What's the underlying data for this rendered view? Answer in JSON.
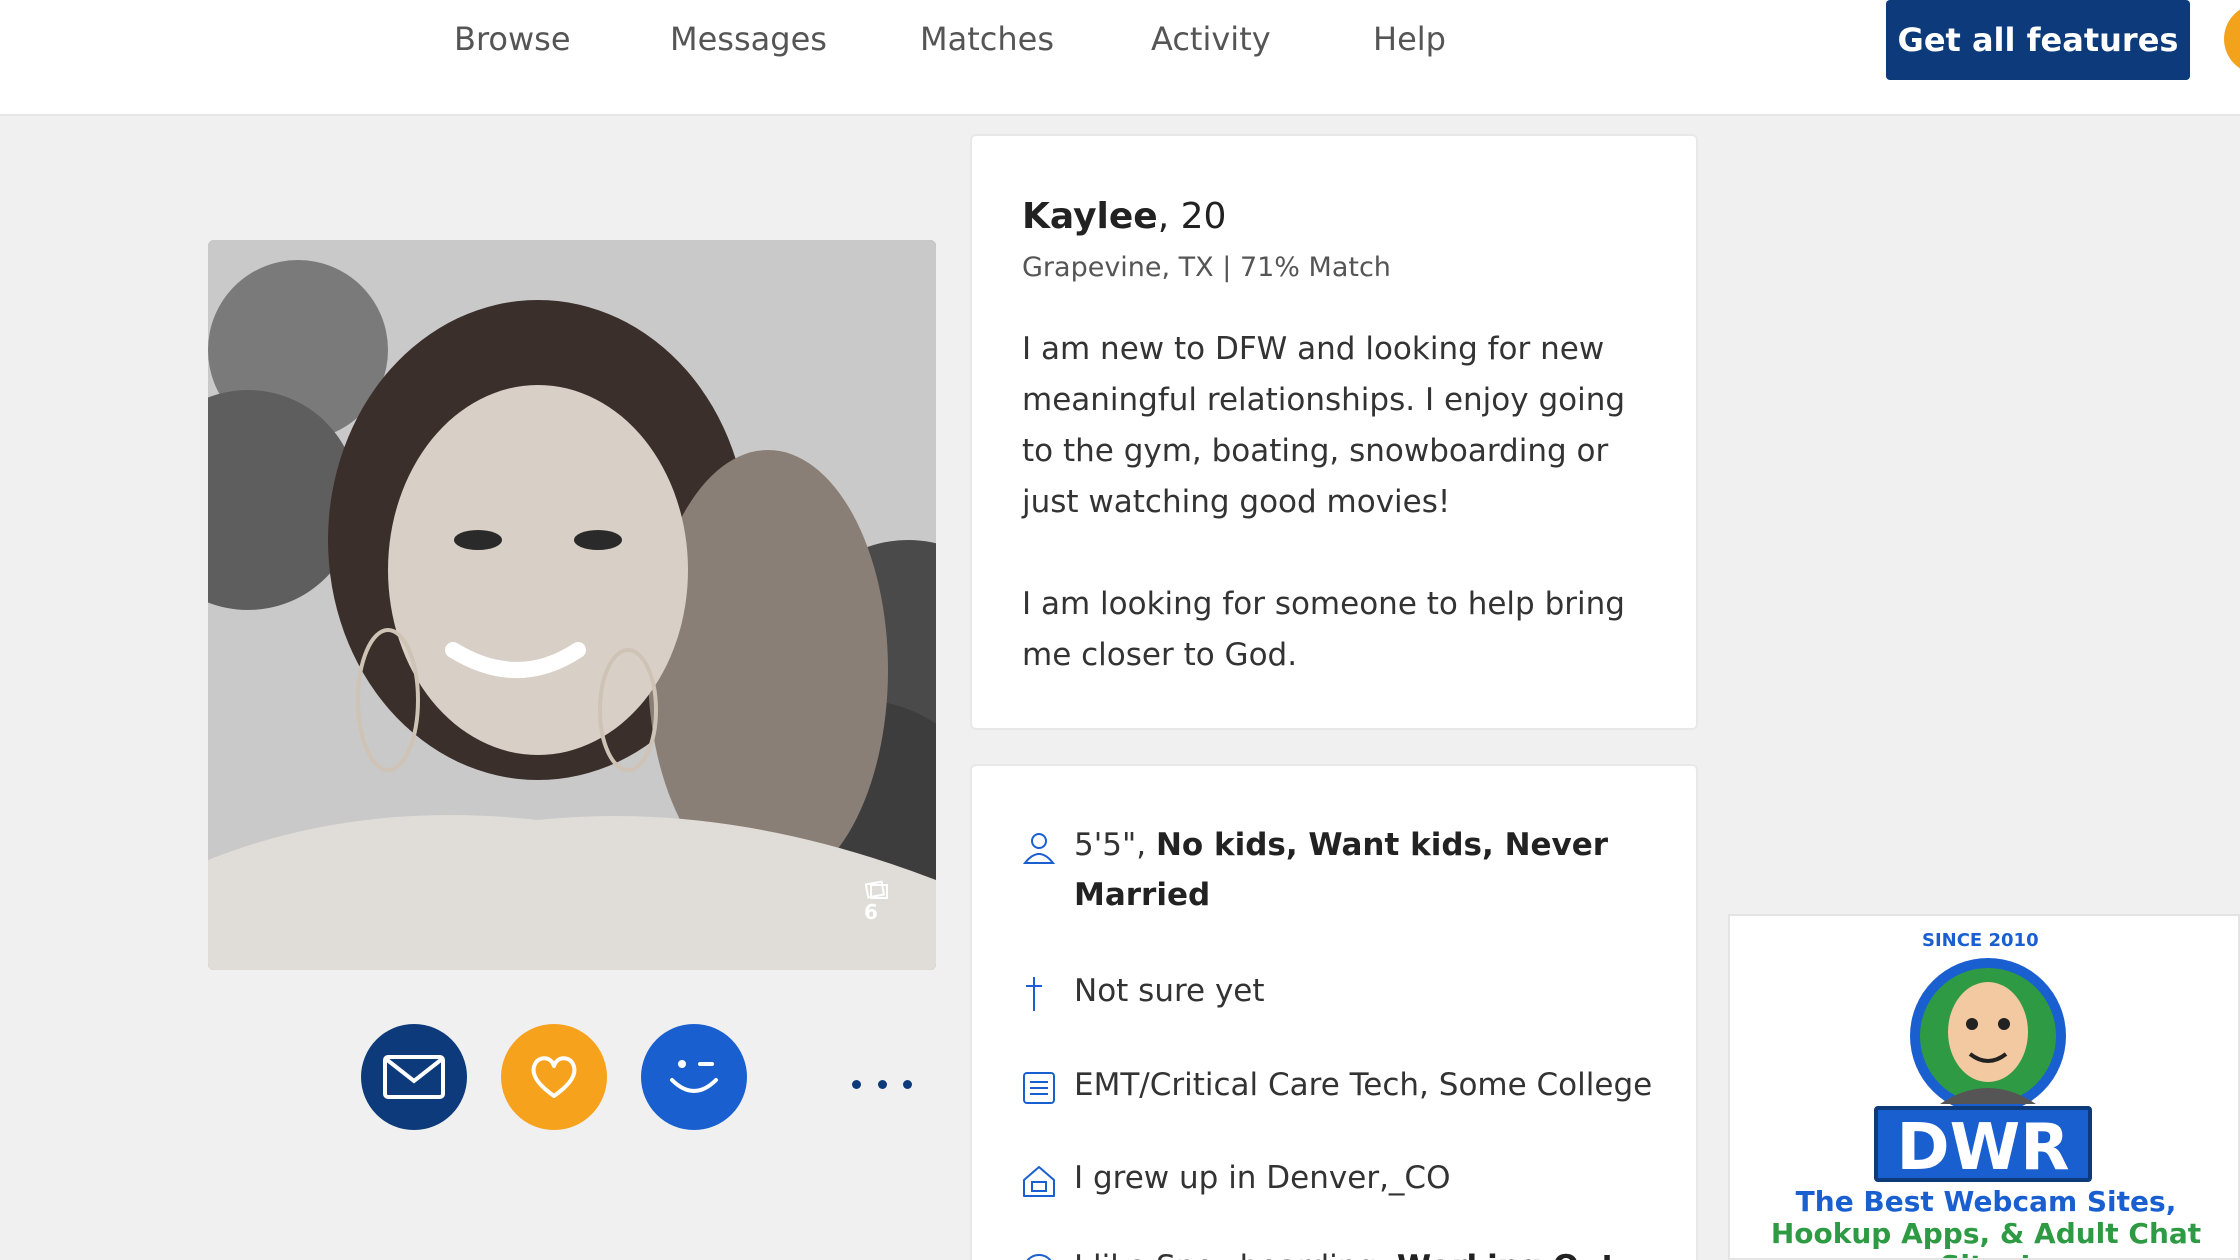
{
  "nav": {
    "items": [
      "Browse",
      "Messages",
      "Matches",
      "Activity",
      "Help"
    ],
    "cta": "Get all features"
  },
  "profile": {
    "name": "Kaylee",
    "age": ", 20",
    "location_match": "Grapevine, TX | 71% Match",
    "photo_count": "6",
    "bio": [
      "I am new to DFW and looking for new meaningful relationships. I enjoy going to the gym, boating, snowboarding or just watching good movies!",
      "I am looking for someone to help bring me closer to God."
    ]
  },
  "actions": {
    "message_icon": "envelope-icon",
    "like_icon": "heart-icon",
    "wink_icon": "wink-icon",
    "more_icon": "more-dots-icon"
  },
  "details": {
    "basics_plain": "5'5\", ",
    "basics_bold": "No kids, Want kids, Never Married",
    "religion": "Not sure yet",
    "occupation": "EMT/Critical Care Tech, Some College",
    "hometown": "I grew up in Denver,_CO",
    "interests_plain": "I like Snowboarding, ",
    "interests_bold": "Working Out"
  },
  "ad": {
    "since": "SINCE 2010",
    "logo": "DWR",
    "tagline_1": "The Best Webcam Sites,",
    "tagline_2": "Hookup Apps, & Adult Chat Sites!"
  },
  "colors": {
    "navy": "#0d3a7a",
    "orange": "#f7a21c",
    "blue": "#1a5fd0",
    "green": "#2e9a43"
  }
}
